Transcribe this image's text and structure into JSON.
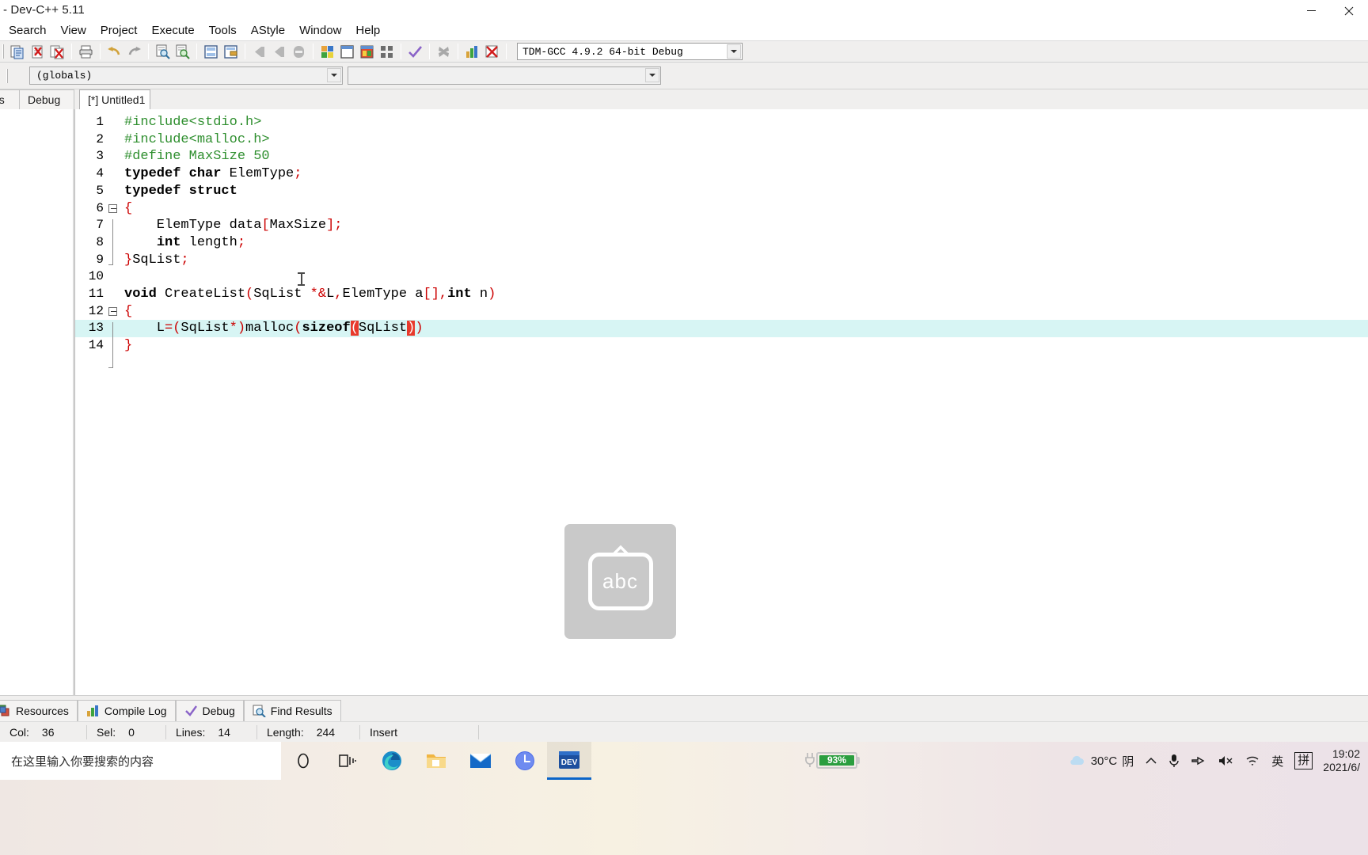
{
  "window": {
    "title": "- Dev-C++ 5.11",
    "minimize_label": "minimize",
    "close_label": "close"
  },
  "menubar": {
    "items": [
      {
        "label": "Search"
      },
      {
        "label": "View"
      },
      {
        "label": "Project"
      },
      {
        "label": "Execute"
      },
      {
        "label": "Tools"
      },
      {
        "label": "AStyle"
      },
      {
        "label": "Window"
      },
      {
        "label": "Help"
      }
    ]
  },
  "toolbar": {
    "compiler_combo": {
      "value": "TDM-GCC 4.9.2 64-bit Debug"
    },
    "buttons": [
      {
        "name": "new-file-icon"
      },
      {
        "name": "open-file-icon"
      },
      {
        "name": "save-file-icon"
      },
      {
        "name": "print-icon"
      },
      {
        "name": "undo-icon"
      },
      {
        "name": "redo-icon"
      },
      {
        "name": "find-icon"
      },
      {
        "name": "replace-icon"
      },
      {
        "name": "goto-line-icon"
      },
      {
        "name": "goto-function-icon"
      },
      {
        "name": "back-icon"
      },
      {
        "name": "forward-icon"
      },
      {
        "name": "toggle-bookmark-icon"
      },
      {
        "name": "compile-icon"
      },
      {
        "name": "run-icon"
      },
      {
        "name": "compile-and-run-icon"
      },
      {
        "name": "rebuild-all-icon"
      },
      {
        "name": "syntax-check-icon"
      },
      {
        "name": "stop-icon"
      },
      {
        "name": "profile-icon"
      },
      {
        "name": "debug-icon"
      }
    ]
  },
  "browser_bar": {
    "scope_combo": {
      "value": "(globals)"
    },
    "member_combo": {
      "value": ""
    }
  },
  "tabs": {
    "left_panel": [
      {
        "label": "sses"
      },
      {
        "label": "Debug"
      }
    ],
    "editor": [
      {
        "label": "[*] Untitled1",
        "active": true
      }
    ]
  },
  "editor": {
    "lines": [
      {
        "n": "1",
        "tokens": [
          {
            "t": "#include<stdio.h>",
            "c": "pp"
          }
        ]
      },
      {
        "n": "2",
        "tokens": [
          {
            "t": "#include<malloc.h>",
            "c": "pp"
          }
        ]
      },
      {
        "n": "3",
        "tokens": [
          {
            "t": "#define MaxSize 50",
            "c": "pp"
          }
        ]
      },
      {
        "n": "4",
        "tokens": [
          {
            "t": "typedef char",
            "c": "k"
          },
          {
            "t": " ElemType",
            "c": "id"
          },
          {
            "t": ";",
            "c": "p"
          }
        ]
      },
      {
        "n": "5",
        "tokens": [
          {
            "t": "typedef struct",
            "c": "k"
          }
        ]
      },
      {
        "n": "6",
        "tokens": [
          {
            "t": "{",
            "c": "p"
          }
        ],
        "fold": "open"
      },
      {
        "n": "7",
        "tokens": [
          {
            "t": "    ElemType data",
            "c": "id"
          },
          {
            "t": "[",
            "c": "p"
          },
          {
            "t": "MaxSize",
            "c": "id"
          },
          {
            "t": "]",
            "c": "p"
          },
          {
            "t": ";",
            "c": "p"
          }
        ]
      },
      {
        "n": "8",
        "tokens": [
          {
            "t": "    ",
            "c": "id"
          },
          {
            "t": "int",
            "c": "k"
          },
          {
            "t": " length",
            "c": "id"
          },
          {
            "t": ";",
            "c": "p"
          }
        ]
      },
      {
        "n": "9",
        "tokens": [
          {
            "t": "}",
            "c": "p"
          },
          {
            "t": "SqList",
            "c": "id"
          },
          {
            "t": ";",
            "c": "p"
          }
        ],
        "fold": "end"
      },
      {
        "n": "10",
        "tokens": []
      },
      {
        "n": "11",
        "tokens": [
          {
            "t": "void",
            "c": "k"
          },
          {
            "t": " CreateList",
            "c": "id"
          },
          {
            "t": "(",
            "c": "p"
          },
          {
            "t": "SqList ",
            "c": "id"
          },
          {
            "t": "*&",
            "c": "p"
          },
          {
            "t": "L",
            "c": "id"
          },
          {
            "t": ",",
            "c": "p"
          },
          {
            "t": "ElemType a",
            "c": "id"
          },
          {
            "t": "[]",
            "c": "p"
          },
          {
            "t": ",",
            "c": "p"
          },
          {
            "t": "int",
            "c": "k"
          },
          {
            "t": " n",
            "c": "id"
          },
          {
            "t": ")",
            "c": "p"
          }
        ]
      },
      {
        "n": "12",
        "tokens": [
          {
            "t": "{",
            "c": "p"
          }
        ],
        "fold": "open"
      },
      {
        "n": "13",
        "highlight": true,
        "tokens": [
          {
            "t": "    L",
            "c": "id"
          },
          {
            "t": "=(",
            "c": "p"
          },
          {
            "t": "SqList",
            "c": "id"
          },
          {
            "t": "*)",
            "c": "p"
          },
          {
            "t": "malloc",
            "c": "id"
          },
          {
            "t": "(",
            "c": "p"
          },
          {
            "t": "sizeof",
            "c": "k"
          },
          {
            "t": "(",
            "c": "brk"
          },
          {
            "t": "SqList",
            "c": "id"
          },
          {
            "t": ")",
            "c": "brk"
          },
          {
            "t": ")",
            "c": "p"
          }
        ]
      },
      {
        "n": "14",
        "tokens": [
          {
            "t": "}",
            "c": "p"
          }
        ],
        "fold": "end"
      }
    ]
  },
  "bottom_tabs": [
    {
      "label": "Resources",
      "icon": "resources-icon"
    },
    {
      "label": "Compile Log",
      "icon": "compile-log-icon"
    },
    {
      "label": "Debug",
      "icon": "debug-check-icon"
    },
    {
      "label": "Find Results",
      "icon": "find-results-icon"
    }
  ],
  "statusbar": {
    "col_label": "Col:",
    "col_value": "36",
    "sel_label": "Sel:",
    "sel_value": "0",
    "lines_label": "Lines:",
    "lines_value": "14",
    "length_label": "Length:",
    "length_value": "244",
    "mode": "Insert"
  },
  "ime_overlay": {
    "key_label": "abc"
  },
  "taskbar": {
    "search_placeholder": "在这里输入你要搜索的内容",
    "apps": [
      {
        "name": "cortana-icon"
      },
      {
        "name": "task-view-icon"
      },
      {
        "name": "edge-icon"
      },
      {
        "name": "file-explorer-icon"
      },
      {
        "name": "mail-icon"
      },
      {
        "name": "clock-app-icon"
      },
      {
        "name": "dev-cpp-icon"
      }
    ],
    "battery_percent": "93%",
    "weather_temp": "30°C",
    "weather_desc": "阴",
    "ime_lang": "英",
    "ime_mode": "拼",
    "time": "19:02",
    "date": "2021/6/"
  },
  "colors": {
    "accent": "#0a64c8",
    "preprocessor": "#2f8f2f",
    "punctuation": "#cc0000",
    "bracket_match_bg": "#e83a2c",
    "active_line_bg": "#d7f5f4",
    "battery_green": "#2a9e3f"
  }
}
